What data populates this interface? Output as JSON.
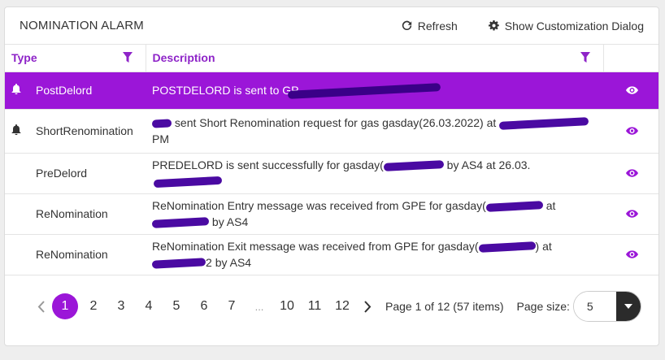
{
  "header": {
    "title": "NOMINATION ALARM",
    "refresh_label": "Refresh",
    "customize_label": "Show Customization Dialog"
  },
  "columns": {
    "type": "Type",
    "description": "Description"
  },
  "rows": [
    {
      "type": "PostDelord",
      "bell": true,
      "selected": true,
      "desc_before": "POSTDELORD is sent to GP",
      "desc_after": "",
      "desc_tail": ""
    },
    {
      "type": "ShortRenomination",
      "bell": true,
      "selected": false,
      "desc_before": "",
      "desc_mid": "sent Short Renomination request for gas gasday(26.03.2022) at",
      "desc_line2": "PM"
    },
    {
      "type": "PreDelord",
      "bell": false,
      "selected": false,
      "desc_before": "PREDELORD is sent successfully for gasday(",
      "desc_mid": "by AS4 at 26.03."
    },
    {
      "type": "ReNomination",
      "bell": false,
      "selected": false,
      "desc_line1": "ReNomination Entry message was received from GPE for gasday(",
      "desc_at": "at",
      "desc_line2": "by AS4"
    },
    {
      "type": "ReNomination",
      "bell": false,
      "selected": false,
      "desc_line1": "ReNomination Exit message was received from GPE for gasday(",
      "desc_at": ") at",
      "desc_line2_pre": "2",
      "desc_line2": "by AS4"
    }
  ],
  "pager": {
    "pages": [
      "1",
      "2",
      "3",
      "4",
      "5",
      "6",
      "7",
      "...",
      "10",
      "11",
      "12"
    ],
    "active": "1",
    "info": "Page 1 of 12 (57 items)",
    "size_label": "Page size:",
    "size_value": "5"
  },
  "colors": {
    "accent": "#9b16d8",
    "header_text": "#8e24c8",
    "redaction": "#4a0aa2"
  },
  "icons": {
    "refresh": "refresh-icon",
    "customize": "gear-icon",
    "filter": "filter-icon",
    "bell": "bell-icon",
    "view": "eye-icon",
    "prev": "chevron-left-icon",
    "next": "chevron-right-icon",
    "dropdown": "caret-down-icon"
  }
}
